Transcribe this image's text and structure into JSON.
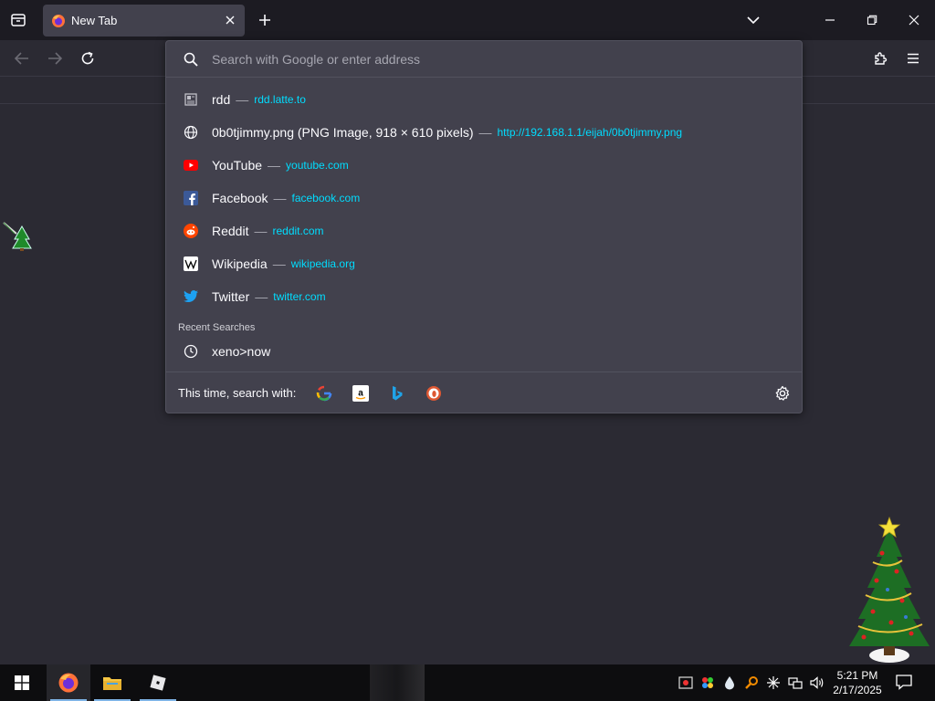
{
  "browser": {
    "tab": {
      "title": "New Tab"
    },
    "urlbar": {
      "placeholder": "Search with Google or enter address",
      "results": [
        {
          "title": "rdd",
          "url": "rdd.latte.to",
          "icon": "page-icon"
        },
        {
          "title": "0b0tjimmy.png (PNG Image, 918 × 610 pixels)",
          "url": "http://192.168.1.1/eijah/0b0tjimmy.png",
          "icon": "globe-icon"
        },
        {
          "title": "YouTube",
          "url": "youtube.com",
          "icon": "youtube-icon"
        },
        {
          "title": "Facebook",
          "url": "facebook.com",
          "icon": "facebook-icon"
        },
        {
          "title": "Reddit",
          "url": "reddit.com",
          "icon": "reddit-icon"
        },
        {
          "title": "Wikipedia",
          "url": "wikipedia.org",
          "icon": "wikipedia-icon"
        },
        {
          "title": "Twitter",
          "url": "twitter.com",
          "icon": "twitter-icon"
        }
      ],
      "separator": "—",
      "recent_searches_label": "Recent Searches",
      "recent_search": "xeno>now",
      "search_with_label": "This time, search with:",
      "engines": [
        "google-icon",
        "amazon-icon",
        "bing-icon",
        "duckduckgo-icon"
      ]
    }
  },
  "taskbar": {
    "time": "5:21 PM",
    "date": "2/17/2025"
  },
  "colors": {
    "accent_link": "#00ddff",
    "panel": "#42414d",
    "toolbar": "#2b2a33",
    "frame": "#1c1b22"
  }
}
